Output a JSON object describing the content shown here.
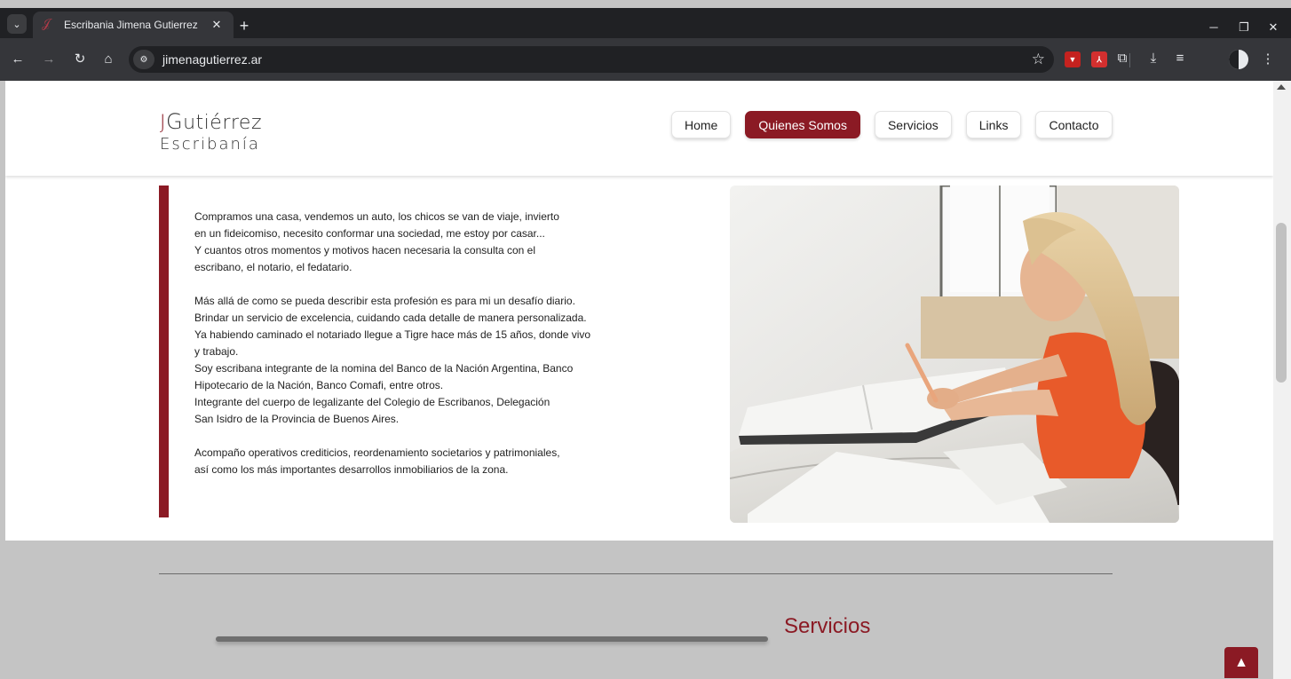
{
  "browser": {
    "tab_title": "Escribania Jimena Gutierrez",
    "tab_close": "✕",
    "new_tab": "+",
    "url": "jimenagutierrez.ar",
    "controls": {
      "minimize": "─",
      "restore": "❐",
      "close": "✕"
    },
    "nav": {
      "back": "←",
      "forward": "→",
      "reload": "↻",
      "home": "⌂"
    },
    "star": "☆",
    "site_info": "⚙",
    "menu": "⋮",
    "tab_menu": "⌄"
  },
  "header": {
    "logo": {
      "j": "J",
      "g": "G",
      "rest": "utiérrez",
      "sub": "Escribanía"
    },
    "nav": [
      {
        "label": "Home",
        "active": false
      },
      {
        "label": "Quienes Somos",
        "active": true
      },
      {
        "label": "Servicios",
        "active": false
      },
      {
        "label": "Links",
        "active": false
      },
      {
        "label": "Contacto",
        "active": false
      }
    ]
  },
  "about": {
    "p1": [
      "Compramos una casa, vendemos un auto, los chicos se van de viaje, invierto",
      "en un fideicomiso, necesito conformar una sociedad, me estoy por casar...",
      "Y cuantos otros momentos y motivos hacen necesaria la consulta con el",
      "escribano, el notario, el fedatario."
    ],
    "p2": [
      "Más allá de como se pueda describir esta profesión es para mi un desafío diario.",
      "Brindar un servicio de excelencia, cuidando cada detalle de manera personalizada.",
      "Ya habiendo caminado el notariado llegue a Tigre hace más de 15 años, donde vivo",
      "y trabajo.",
      "Soy escribana integrante de la nomina del Banco de la Nación Argentina, Banco",
      "Hipotecario de la Nación, Banco Comafi, entre otros.",
      "Integrante del cuerpo de legalizante del Colegio de Escribanos, Delegación",
      "San Isidro de la Provincia de Buenos Aires."
    ],
    "p3": [
      "Acompaño operativos crediticios, reordenamiento societarios y patrimoniales,",
      "así como los más importantes desarrollos inmobiliarios de la zona."
    ]
  },
  "servicios": {
    "title": "Servicios"
  },
  "scroll_top": "▲",
  "colors": {
    "brand": "#8b1a24",
    "page_bg": "#c4c4c4"
  },
  "icons": [
    "tab-menu-icon",
    "favicon-icon",
    "close-icon",
    "plus-icon",
    "back-icon",
    "forward-icon",
    "reload-icon",
    "home-icon",
    "site-info-icon",
    "star-icon",
    "extension-icon",
    "pdf-icon",
    "puzzle-icon",
    "download-icon",
    "media-icon",
    "profile-icon",
    "menu-icon",
    "chevron-up-icon"
  ]
}
